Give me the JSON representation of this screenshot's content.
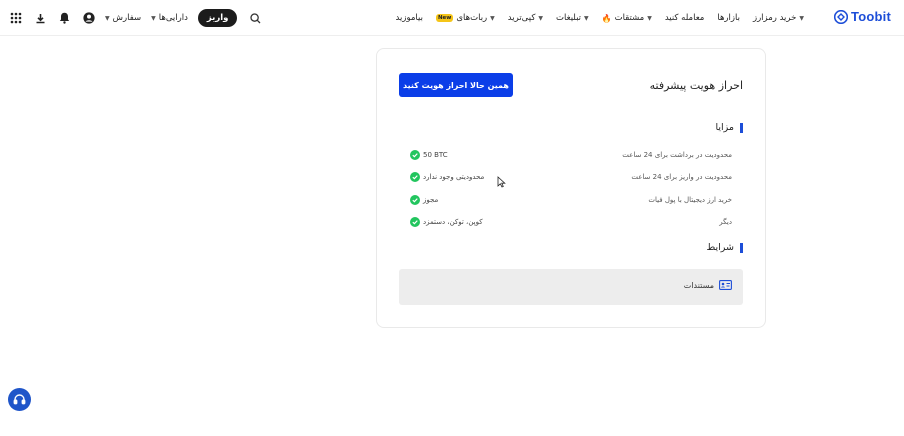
{
  "header": {
    "logo_text": "Toobit",
    "nav": [
      {
        "label": "خرید رمزارز",
        "has_caret": true
      },
      {
        "label": "بازارها",
        "has_caret": false
      },
      {
        "label": "معامله کنید",
        "has_caret": false
      },
      {
        "label": "مشتقات",
        "has_caret": true,
        "icon": "fire-icon"
      },
      {
        "label": "تبلیغات",
        "has_caret": true
      },
      {
        "label": "کپی‌ترید",
        "has_caret": true
      },
      {
        "label": "ربات‌های",
        "has_caret": true,
        "badge": "New"
      },
      {
        "label": "بیاموزید",
        "has_caret": false
      }
    ],
    "deposit_label": "واریز",
    "assets_label": "دارایی‌ها",
    "orders_label": "سفارش"
  },
  "card": {
    "title": "احراز هویت پیشرفته",
    "verify_button": "همین حالا احراز هویت کنید",
    "benefits_heading": "مزایا",
    "benefits": [
      {
        "label": "محدودیت در برداشت برای 24 ساعت",
        "value": "50 BTC"
      },
      {
        "label": "محدودیت در واریز برای 24 ساعت",
        "value": "محدودیتی وجود ندارد"
      },
      {
        "label": "خرید ارز دیجیتال با پول فیات",
        "value": "مجوز"
      },
      {
        "label": "دیگر",
        "value": "کوپن، توکن، دستمزد"
      }
    ],
    "conditions_heading": "شرایط",
    "documents_label": "مستندات"
  },
  "colors": {
    "accent": "#1d4ed8",
    "button": "#0b3ee8",
    "check": "#22c55e",
    "deposit_bg": "#1c1c1c",
    "badge": "#f5c518"
  }
}
